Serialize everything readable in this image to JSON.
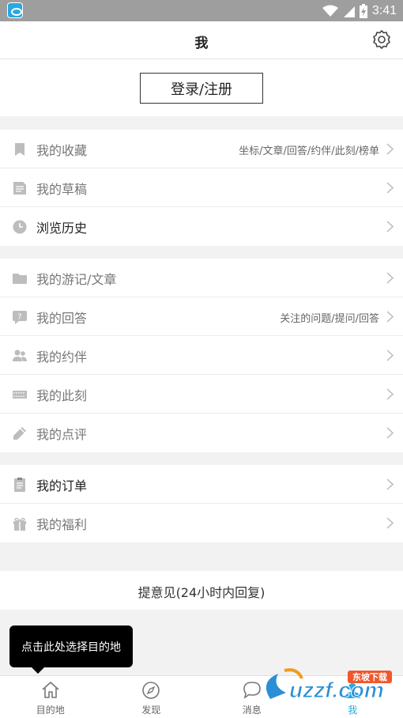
{
  "status_bar": {
    "time": "3:41"
  },
  "header": {
    "title": "我"
  },
  "login": {
    "label": "登录/注册"
  },
  "groups": [
    {
      "items": [
        {
          "label": "我的收藏",
          "hint": "坐标/文章/回答/约伴/此刻/榜单"
        },
        {
          "label": "我的草稿",
          "hint": ""
        },
        {
          "label": "浏览历史",
          "hint": ""
        }
      ]
    },
    {
      "items": [
        {
          "label": "我的游记/文章",
          "hint": ""
        },
        {
          "label": "我的回答",
          "hint": "关注的问题/提问/回答"
        },
        {
          "label": "我的约伴",
          "hint": ""
        },
        {
          "label": "我的此刻",
          "hint": ""
        },
        {
          "label": "我的点评",
          "hint": ""
        }
      ]
    },
    {
      "items": [
        {
          "label": "我的订单",
          "hint": ""
        },
        {
          "label": "我的福利",
          "hint": ""
        }
      ]
    }
  ],
  "feedback": {
    "label": "提意见(24小时内回复)"
  },
  "tooltip": {
    "text": "点击此处选择目的地"
  },
  "tabs": [
    {
      "label": "目的地",
      "icon": "home-icon"
    },
    {
      "label": "发现",
      "icon": "compass-icon"
    },
    {
      "label": "消息",
      "icon": "chat-icon"
    },
    {
      "label": "我",
      "icon": "profile-icon",
      "active": true
    }
  ],
  "watermark": {
    "text": "uzzf.com",
    "badge": "东坡下载"
  },
  "colors": {
    "accent": "#27a9e1",
    "status_bar": "#9e9e9e",
    "page_bg": "#f2f2f2"
  }
}
